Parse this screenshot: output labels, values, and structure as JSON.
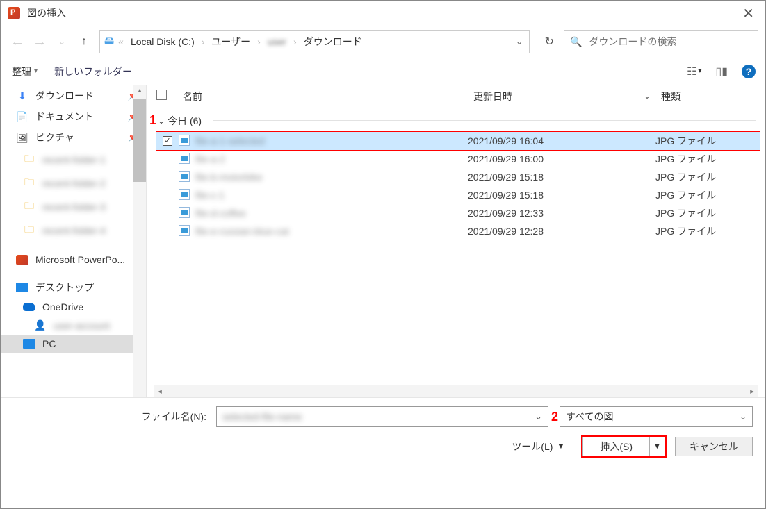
{
  "title": "図の挿入",
  "breadcrumb": {
    "drive": "Local Disk (C:)",
    "user_label": "ユーザー",
    "user_name": "user",
    "dest": "ダウンロード"
  },
  "search": {
    "placeholder": "ダウンロードの検索"
  },
  "toolbar": {
    "organize": "整理",
    "new_folder": "新しいフォルダー"
  },
  "sidebar": {
    "downloads": "ダウンロード",
    "documents": "ドキュメント",
    "pictures": "ピクチャ",
    "recent": [
      "recent-folder-1",
      "recent-folder-2",
      "recent-folder-3",
      "recent-folder-4"
    ],
    "powerpoint": "Microsoft PowerPo...",
    "desktop": "デスクトップ",
    "onedrive": "OneDrive",
    "onedrive_sub": "user-account",
    "pc": "PC"
  },
  "columns": {
    "name": "名前",
    "date": "更新日時",
    "type": "種類"
  },
  "group": {
    "label": "今日 (6)"
  },
  "files": [
    {
      "name": "file-a-1-selected",
      "date": "2021/09/29 16:04",
      "type": "JPG ファイル",
      "selected": true
    },
    {
      "name": "file-a-2",
      "date": "2021/09/29 16:00",
      "type": "JPG ファイル"
    },
    {
      "name": "file-b-motorbike",
      "date": "2021/09/29 15:18",
      "type": "JPG ファイル"
    },
    {
      "name": "file-c-1",
      "date": "2021/09/29 15:18",
      "type": "JPG ファイル"
    },
    {
      "name": "file-d-coffee",
      "date": "2021/09/29 12:33",
      "type": "JPG ファイル"
    },
    {
      "name": "file-e-russian-blue-cat",
      "date": "2021/09/29 12:28",
      "type": "JPG ファイル"
    }
  ],
  "footer": {
    "filename_label": "ファイル名(N):",
    "filename_value": "selected-file-name",
    "filter": "すべての図",
    "tools": "ツール(L)",
    "insert": "挿入(S)",
    "cancel": "キャンセル"
  },
  "annotations": {
    "a1": "1",
    "a2": "2"
  }
}
